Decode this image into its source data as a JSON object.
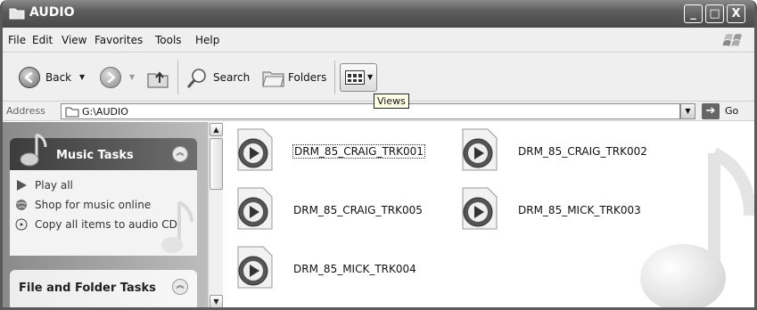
{
  "window": {
    "title": "AUDIO"
  },
  "window_controls": {
    "minimize": "_",
    "maximize": "□",
    "close": "X"
  },
  "menu": [
    {
      "label": "File"
    },
    {
      "label": "Edit"
    },
    {
      "label": "View"
    },
    {
      "label": "Favorites"
    },
    {
      "label": "Tools"
    },
    {
      "label": "Help"
    }
  ],
  "toolbar": {
    "back_label": "Back",
    "search_label": "Search",
    "folders_label": "Folders",
    "views_tooltip": "Views"
  },
  "address": {
    "label": "Address",
    "value": "G:\\AUDIO",
    "go_label": "Go"
  },
  "left_pane": {
    "music_tasks": {
      "title": "Music Tasks",
      "items": [
        {
          "label": "Play all",
          "icon": "play-icon"
        },
        {
          "label": "Shop for music online",
          "icon": "globe-icon"
        },
        {
          "label": "Copy all items to audio CD",
          "icon": "cd-icon"
        }
      ]
    },
    "file_folder_tasks": {
      "title": "File and Folder Tasks"
    }
  },
  "files": [
    {
      "name": "DRM_85_CRAIG_TRK001",
      "selected": true
    },
    {
      "name": "DRM_85_CRAIG_TRK002",
      "selected": false
    },
    {
      "name": "DRM_85_CRAIG_TRK005",
      "selected": false
    },
    {
      "name": "DRM_85_MICK_TRK003",
      "selected": false
    },
    {
      "name": "DRM_85_MICK_TRK004",
      "selected": false
    }
  ]
}
